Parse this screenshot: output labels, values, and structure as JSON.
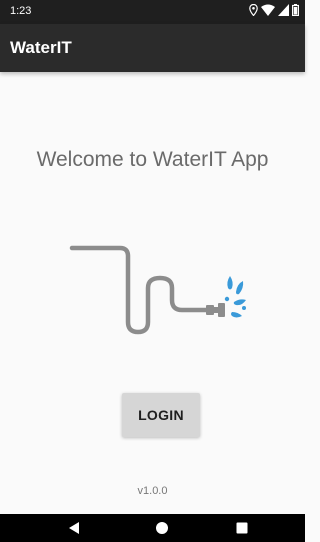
{
  "status_bar": {
    "time": "1:23",
    "icons": [
      "location-icon",
      "wifi-icon",
      "signal-icon",
      "battery-icon"
    ]
  },
  "app_bar": {
    "title": "WaterIT",
    "background": "#2b2b2b"
  },
  "main": {
    "welcome_text": "Welcome to WaterIT App",
    "illustration": "pipe-leak-icon",
    "pipe_color": "#8c8c8c",
    "water_color": "#3a9ad9",
    "login_label": "LOGIN",
    "version": "v1.0.0"
  },
  "nav_bar": {
    "buttons": [
      "back-icon",
      "home-icon",
      "recents-icon"
    ]
  }
}
